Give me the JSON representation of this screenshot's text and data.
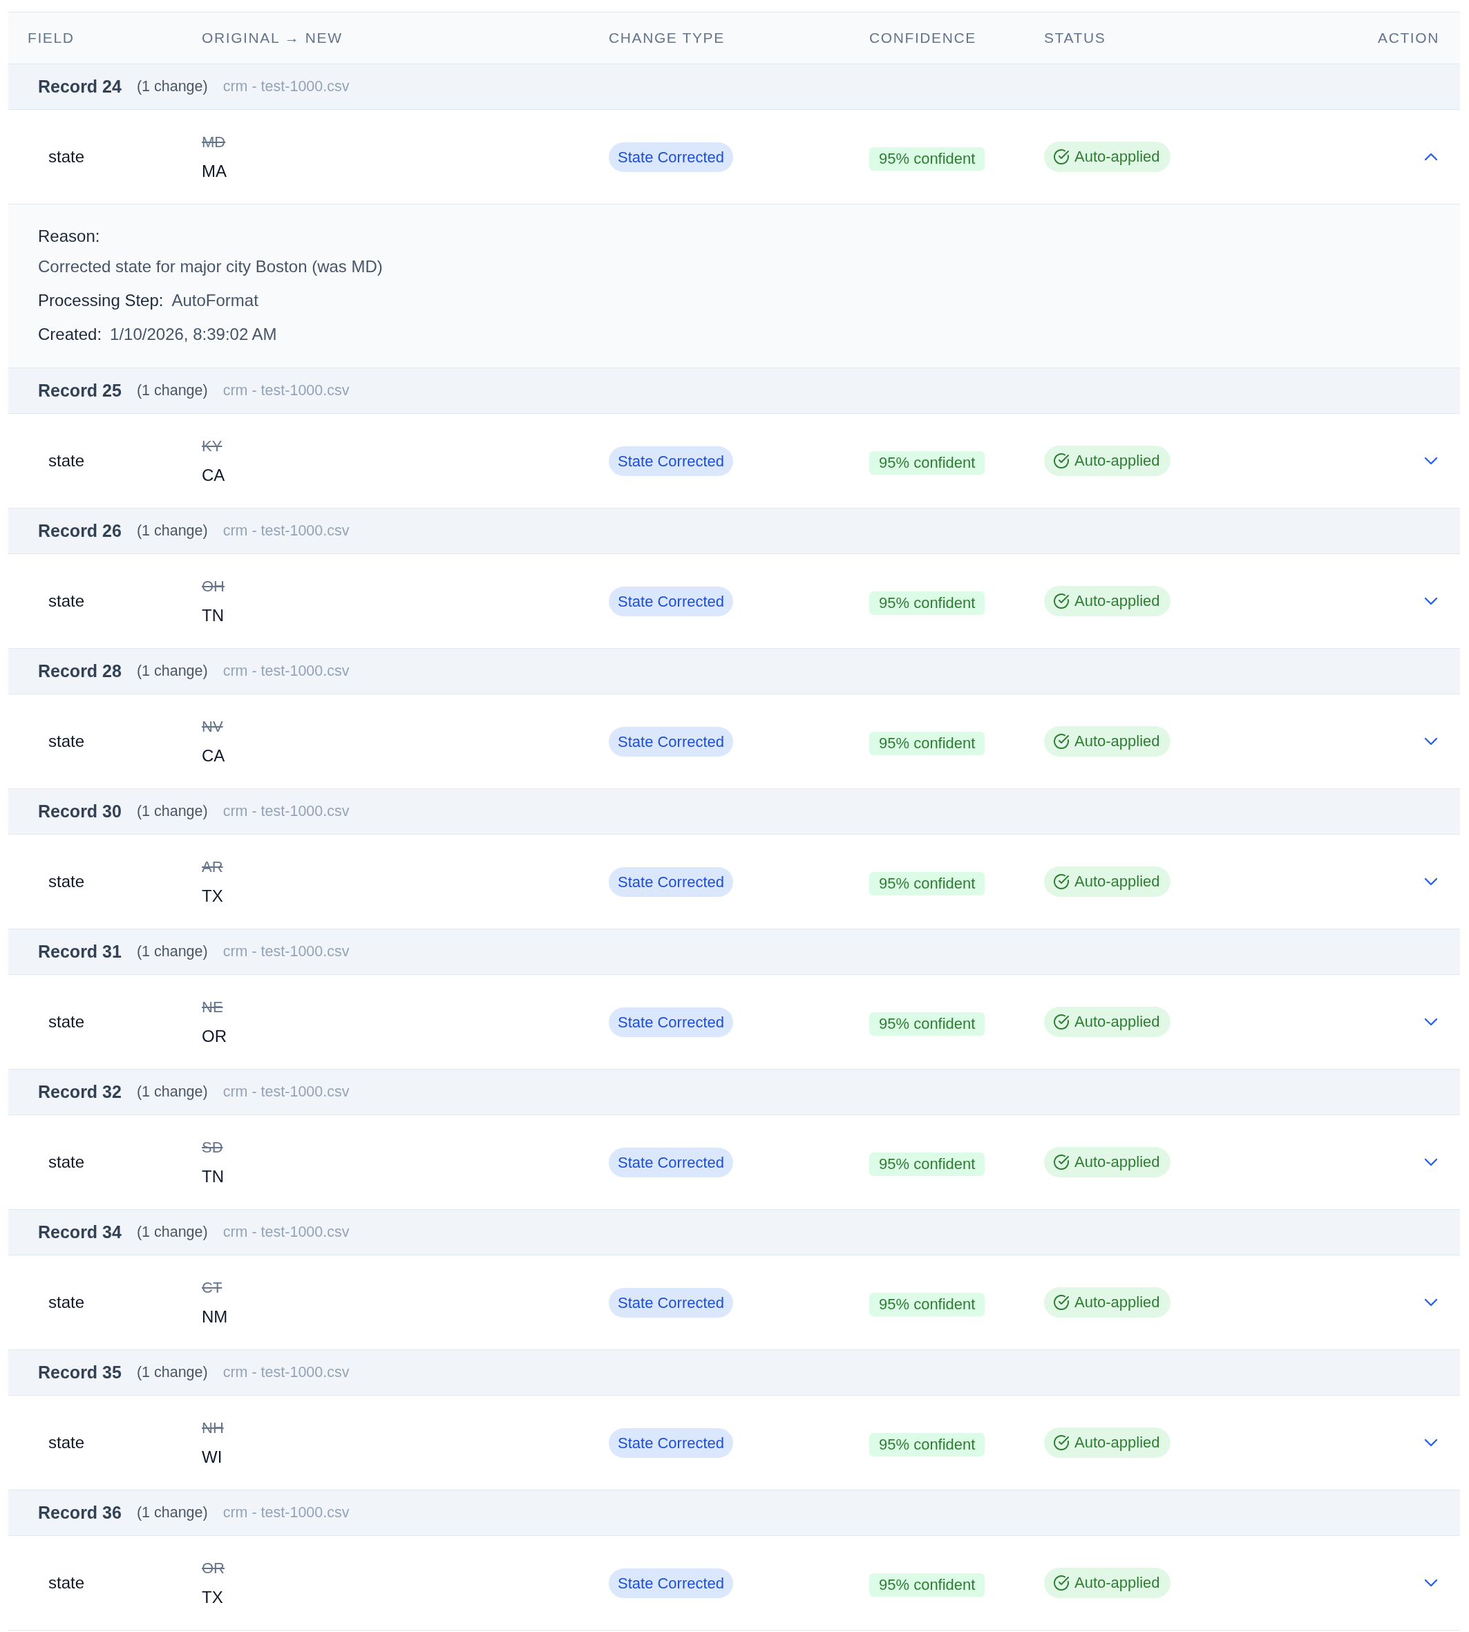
{
  "table": {
    "columns": [
      "FIELD",
      "ORIGINAL → NEW",
      "CHANGE TYPE",
      "CONFIDENCE",
      "STATUS",
      "ACTION"
    ],
    "records": [
      {
        "title": "Record 24",
        "count": "(1 change)",
        "source": "crm - test-1000.csv",
        "changes": [
          {
            "field": "state",
            "original": "MD",
            "new": "MA",
            "change_type": "State Corrected",
            "confidence": "95% confident",
            "status": "Auto-applied",
            "expanded": true,
            "details": {
              "reason_label": "Reason:",
              "reason": "Corrected state for major city Boston (was MD)",
              "step_label": "Processing Step:",
              "step": "AutoFormat",
              "created_label": "Created:",
              "created": "1/10/2026, 8:39:02 AM"
            }
          }
        ]
      },
      {
        "title": "Record 25",
        "count": "(1 change)",
        "source": "crm - test-1000.csv",
        "changes": [
          {
            "field": "state",
            "original": "KY",
            "new": "CA",
            "change_type": "State Corrected",
            "confidence": "95% confident",
            "status": "Auto-applied",
            "expanded": false
          }
        ]
      },
      {
        "title": "Record 26",
        "count": "(1 change)",
        "source": "crm - test-1000.csv",
        "changes": [
          {
            "field": "state",
            "original": "OH",
            "new": "TN",
            "change_type": "State Corrected",
            "confidence": "95% confident",
            "status": "Auto-applied",
            "expanded": false
          }
        ]
      },
      {
        "title": "Record 28",
        "count": "(1 change)",
        "source": "crm - test-1000.csv",
        "changes": [
          {
            "field": "state",
            "original": "NV",
            "new": "CA",
            "change_type": "State Corrected",
            "confidence": "95% confident",
            "status": "Auto-applied",
            "expanded": false
          }
        ]
      },
      {
        "title": "Record 30",
        "count": "(1 change)",
        "source": "crm - test-1000.csv",
        "changes": [
          {
            "field": "state",
            "original": "AR",
            "new": "TX",
            "change_type": "State Corrected",
            "confidence": "95% confident",
            "status": "Auto-applied",
            "expanded": false
          }
        ]
      },
      {
        "title": "Record 31",
        "count": "(1 change)",
        "source": "crm - test-1000.csv",
        "changes": [
          {
            "field": "state",
            "original": "NE",
            "new": "OR",
            "change_type": "State Corrected",
            "confidence": "95% confident",
            "status": "Auto-applied",
            "expanded": false
          }
        ]
      },
      {
        "title": "Record 32",
        "count": "(1 change)",
        "source": "crm - test-1000.csv",
        "changes": [
          {
            "field": "state",
            "original": "SD",
            "new": "TN",
            "change_type": "State Corrected",
            "confidence": "95% confident",
            "status": "Auto-applied",
            "expanded": false
          }
        ]
      },
      {
        "title": "Record 34",
        "count": "(1 change)",
        "source": "crm - test-1000.csv",
        "changes": [
          {
            "field": "state",
            "original": "CT",
            "new": "NM",
            "change_type": "State Corrected",
            "confidence": "95% confident",
            "status": "Auto-applied",
            "expanded": false
          }
        ]
      },
      {
        "title": "Record 35",
        "count": "(1 change)",
        "source": "crm - test-1000.csv",
        "changes": [
          {
            "field": "state",
            "original": "NH",
            "new": "WI",
            "change_type": "State Corrected",
            "confidence": "95% confident",
            "status": "Auto-applied",
            "expanded": false
          }
        ]
      },
      {
        "title": "Record 36",
        "count": "(1 change)",
        "source": "crm - test-1000.csv",
        "changes": [
          {
            "field": "state",
            "original": "OR",
            "new": "TX",
            "change_type": "State Corrected",
            "confidence": "95% confident",
            "status": "Auto-applied",
            "expanded": false
          }
        ]
      }
    ]
  }
}
